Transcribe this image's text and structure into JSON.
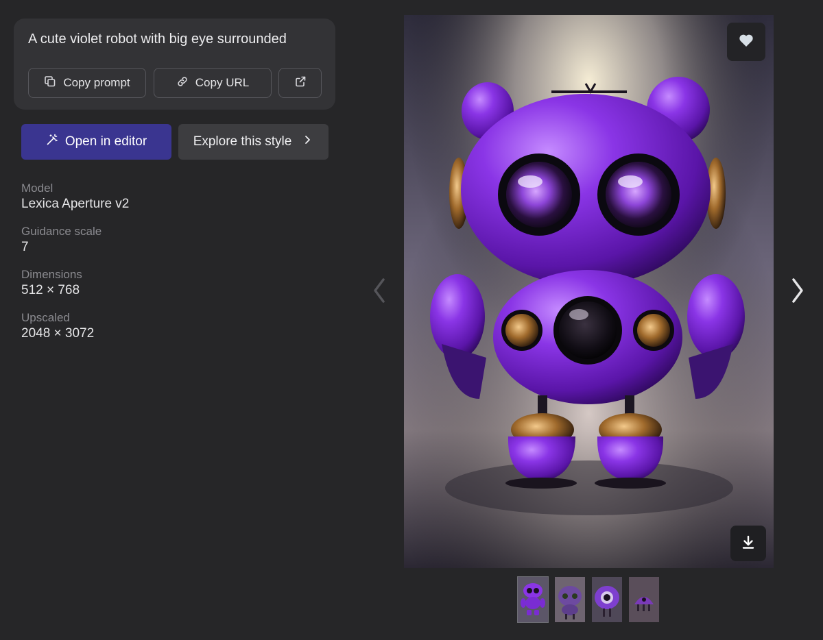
{
  "prompt": {
    "text": "A cute violet robot with big eye surrounded",
    "copy_prompt_label": "Copy prompt",
    "copy_url_label": "Copy URL",
    "copy_prompt_icon": "copy-icon",
    "copy_url_icon": "link-icon",
    "open_external_icon": "external-link-icon"
  },
  "actions": {
    "open_editor_label": "Open in editor",
    "open_editor_icon": "magic-wand-icon",
    "explore_style_label": "Explore this style",
    "explore_style_icon": "chevron-right-icon"
  },
  "meta": [
    {
      "label": "Model",
      "value": "Lexica Aperture v2"
    },
    {
      "label": "Guidance scale",
      "value": "7"
    },
    {
      "label": "Dimensions",
      "value": "512 × 768"
    },
    {
      "label": "Upscaled",
      "value": "2048 × 3072"
    }
  ],
  "viewer": {
    "prev_icon": "chevron-left-icon",
    "next_icon": "chevron-right-icon",
    "like_icon": "heart-icon",
    "download_icon": "download-icon",
    "thumbnail_count": 4,
    "active_thumbnail": 1
  },
  "colors": {
    "background": "#262628",
    "card": "#333336",
    "primary_button": "#3a3590",
    "secondary_button": "#3d3d40",
    "robot_violet": "#7a2fd8"
  }
}
